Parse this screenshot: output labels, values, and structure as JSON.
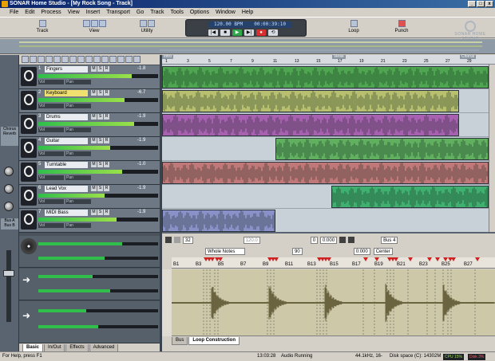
{
  "window": {
    "title": "SONAR Home Studio - [My Rock Song - Track]"
  },
  "menu": [
    "File",
    "Edit",
    "Process",
    "View",
    "Insert",
    "Transport",
    "Go",
    "Track",
    "Tools",
    "Options",
    "Window",
    "Help"
  ],
  "toolbar": {
    "groups": [
      {
        "label": "Track"
      },
      {
        "label": "View"
      },
      {
        "label": "Utility"
      },
      {
        "label": "Loop"
      },
      {
        "label": "Punch"
      }
    ],
    "transport": {
      "tempo": "120.00 BPM",
      "time": "00:00:39:10"
    },
    "logo_text": "SONAR HOME STUDIO"
  },
  "tracks": [
    {
      "index": "1",
      "name": "Fingers",
      "value": "-1.8",
      "meter": 0.78,
      "selected": false
    },
    {
      "index": "2",
      "name": "Keyboard",
      "value": "-6.7",
      "meter": 0.72,
      "selected": true
    },
    {
      "index": "3",
      "name": "Drums",
      "value": "-1.9",
      "meter": 0.8,
      "selected": false
    },
    {
      "index": "4",
      "name": "Guitar",
      "value": "-1.9",
      "meter": 0.6,
      "selected": false
    },
    {
      "index": "5",
      "name": "Turntable",
      "value": "-1.0",
      "meter": 0.7,
      "selected": false
    },
    {
      "index": "6",
      "name": "Lead Vox",
      "value": "-1.9",
      "meter": 0.55,
      "selected": false
    },
    {
      "index": "7",
      "name": "MIDI Bass",
      "value": "-1.9",
      "meter": 0.65,
      "selected": false
    }
  ],
  "track_fields": [
    "Vol",
    "Pan"
  ],
  "leftstrip": {
    "label_a": "Chorus",
    "label_b": "Reverb",
    "bus_a": "Bus A",
    "bus_b": "Bus B"
  },
  "trackpane_tabs": [
    "Basic",
    "In/Out",
    "Effects",
    "Advanced"
  ],
  "ruler": {
    "marks": [
      "1",
      "3",
      "5",
      "7",
      "9",
      "11",
      "13",
      "15",
      "17",
      "19",
      "21",
      "23",
      "25",
      "27",
      "29"
    ],
    "markers": [
      "Intro",
      "Verse",
      "Chorus"
    ]
  },
  "loop_pane": {
    "row1": {
      "beats": "32",
      "tempo": "120.0",
      "pitch": "0",
      "offset": "0:000",
      "bus": "Bus 4"
    },
    "row2": {
      "unit": "Whole Notes",
      "threshold": "90",
      "value2": "0:000",
      "center": "Center"
    },
    "beat_labels": [
      "B1",
      "B3",
      "B5",
      "B7",
      "B9",
      "B11",
      "B13",
      "B15",
      "B17",
      "B19",
      "B21",
      "B23",
      "B25",
      "B27"
    ],
    "tabs": [
      "Bus",
      "Loop Construction"
    ]
  },
  "status": {
    "help": "For Help, press F1",
    "clock": "13:03:28",
    "mode": "Audio Running",
    "audio": "44.1kHz, 16-",
    "disk": "Disk space (C): 14302M",
    "cpu": "CPU 15%",
    "disk_meter": "Disk 3%"
  },
  "colors": {
    "track_fingers": "#4ea650",
    "track_keyboard": "#b8c070",
    "track_drums": "#a860b0",
    "track_guitar": "#60b060",
    "track_turntable": "#c07878",
    "track_leadvox": "#40b070",
    "track_midibass": "#8a90c8"
  }
}
